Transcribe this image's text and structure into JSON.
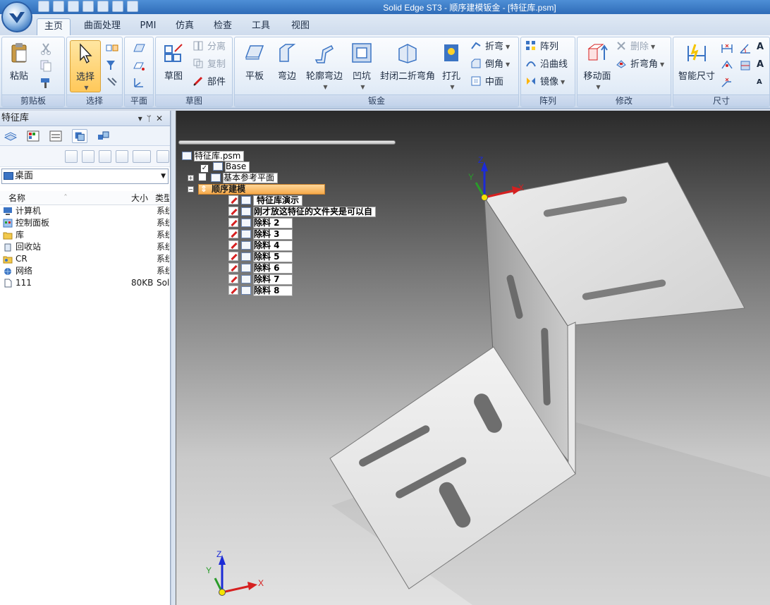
{
  "window": {
    "title": "Solid Edge ST3 - 顺序建模钣金 - [特征库.psm]"
  },
  "tabs": [
    {
      "label": "主页",
      "active": true
    },
    {
      "label": "曲面处理",
      "active": false
    },
    {
      "label": "PMI",
      "active": false
    },
    {
      "label": "仿真",
      "active": false
    },
    {
      "label": "检查",
      "active": false
    },
    {
      "label": "工具",
      "active": false
    },
    {
      "label": "视图",
      "active": false
    }
  ],
  "ribbon": {
    "clipboard": {
      "label": "剪贴板",
      "paste": "粘贴"
    },
    "select": {
      "label": "选择",
      "select_btn": "选择"
    },
    "plane": {
      "label": "平面"
    },
    "sketch": {
      "label": "草图",
      "sketch_btn": "草图",
      "separate": "分离",
      "copy": "复制",
      "part": "部件"
    },
    "sheetmetal": {
      "label": "钣金",
      "tab_btn": "平板",
      "flange": "弯边",
      "contour_flange": "轮廓弯边",
      "dimple": "凹坑",
      "closed_corner": "封闭二折弯角",
      "hole": "打孔",
      "fold": "折弯",
      "chamfer": "倒角",
      "midplane": "中面"
    },
    "pattern": {
      "label": "阵列",
      "pattern_btn": "阵列",
      "along_curve": "沿曲线",
      "mirror": "镜像"
    },
    "modify": {
      "label": "修改",
      "move_face": "移动面",
      "delete": "删除",
      "bend_corner": "折弯角"
    },
    "dimension": {
      "label": "尺寸",
      "smart_dim": "智能尺寸"
    }
  },
  "library_panel": {
    "title": "特征库",
    "location": "桌面",
    "columns": {
      "name": "名称",
      "size": "大小",
      "type": "类型"
    },
    "files": [
      {
        "name": "计算机",
        "size": "",
        "type": "系统"
      },
      {
        "name": "控制面板",
        "size": "",
        "type": "系统"
      },
      {
        "name": "库",
        "size": "",
        "type": "系统"
      },
      {
        "name": "回收站",
        "size": "",
        "type": "系统"
      },
      {
        "name": "CR",
        "size": "",
        "type": "系统"
      },
      {
        "name": "网络",
        "size": "",
        "type": "系统"
      },
      {
        "name": "111",
        "size": "80KB",
        "type": "Sol"
      }
    ]
  },
  "tree": {
    "root": "特征库.psm",
    "base": "Base",
    "ref_planes": "基本参考平面",
    "ordered": "顺序建模",
    "features": [
      "特征库演示",
      "刚才放这特征的文件夹是可以自",
      "除料 2",
      "除料 3",
      "除料 4",
      "除料 5",
      "除料 6",
      "除料 7",
      "除料 8"
    ]
  },
  "axes": {
    "x": "X",
    "y": "Y",
    "z": "Z"
  },
  "colors": {
    "accent": "#2f6cb8",
    "selection": "#ffc85a",
    "tree_highlight": "#f6a94a"
  }
}
